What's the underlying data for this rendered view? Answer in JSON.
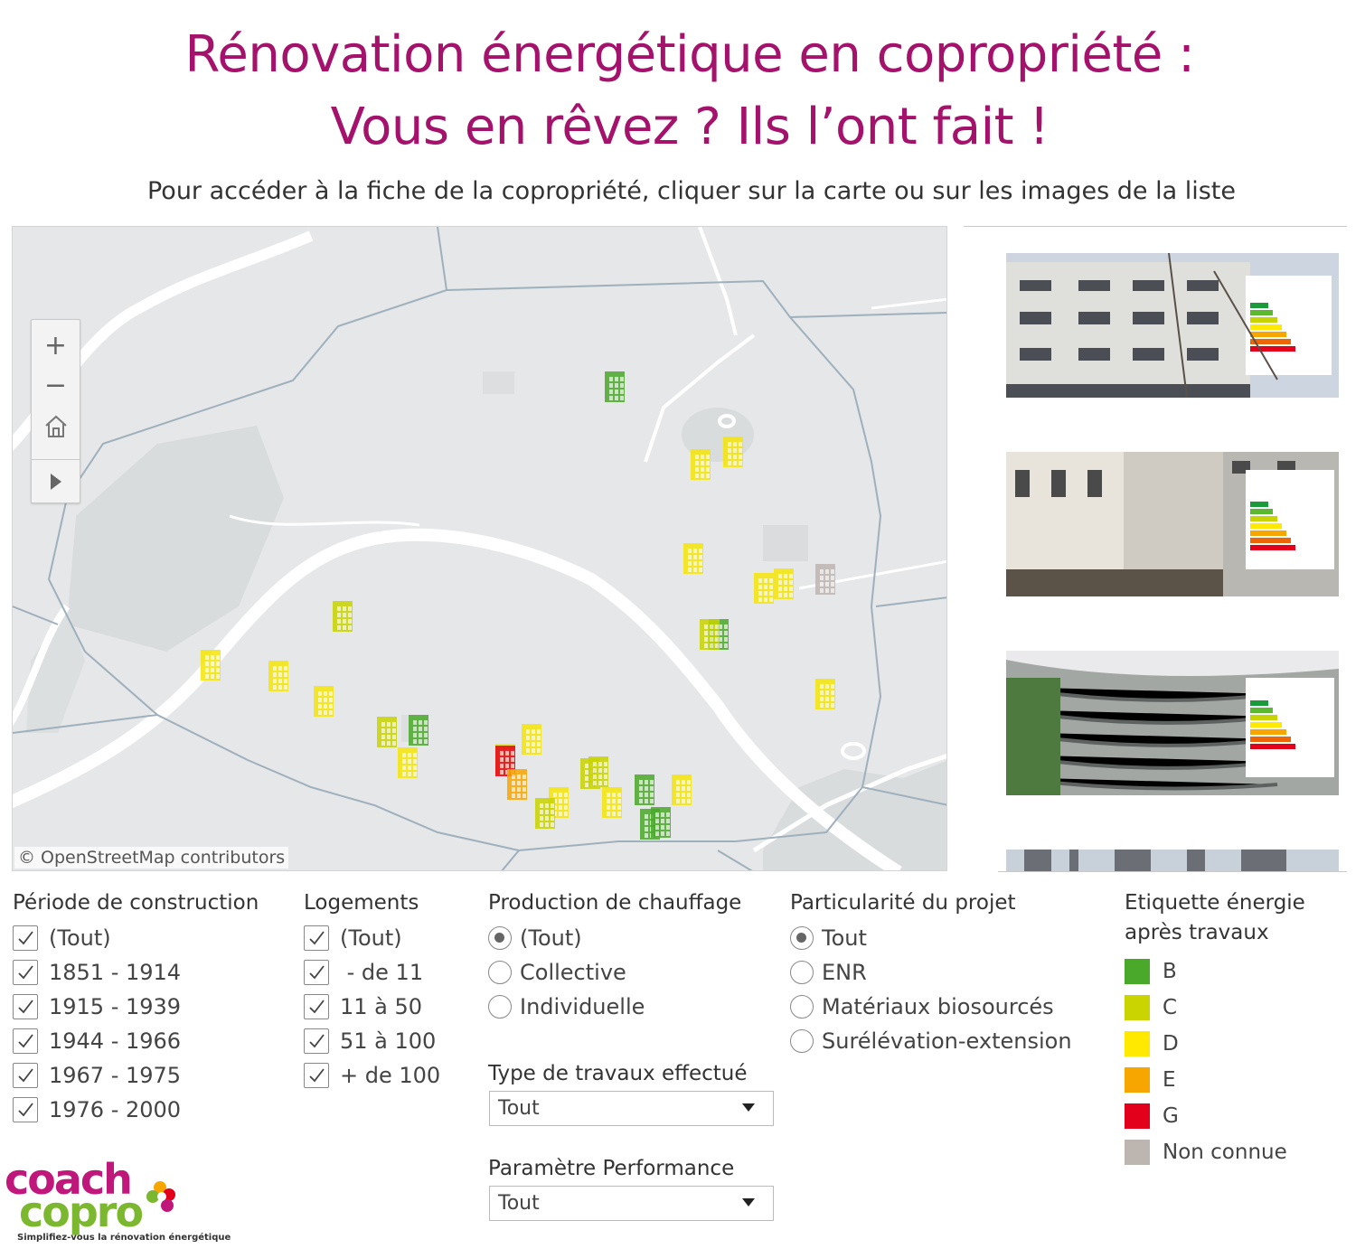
{
  "header": {
    "title_line1": "Rénovation énergétique en copropriété :",
    "title_line2": "Vous en rêvez ? Ils l’ont fait !",
    "subtitle": "Pour accéder à la fiche de la copropriété, cliquer sur la carte ou sur les images de la liste"
  },
  "map": {
    "attribution": "© OpenStreetMap contributors",
    "controls": {
      "zoom_in": "+",
      "zoom_out": "−",
      "home": "home-icon",
      "play": "play-icon"
    },
    "markers": [
      {
        "label": "B",
        "color": "#4aa82b"
      },
      {
        "label": "D",
        "color": "#f5e50a"
      },
      {
        "label": "D",
        "color": "#f5e50a"
      },
      {
        "label": "D",
        "color": "#f5e50a"
      },
      {
        "label": "D",
        "color": "#f5e50a"
      },
      {
        "label": "D",
        "color": "#f5e50a"
      },
      {
        "label": "Non connue",
        "color": "#bdb5b0"
      },
      {
        "label": "C",
        "color": "#c9d400"
      },
      {
        "label": "B",
        "color": "#4aa82b"
      },
      {
        "label": "C",
        "color": "#c9d400"
      },
      {
        "label": "D",
        "color": "#f5e50a"
      },
      {
        "label": "D",
        "color": "#f5e50a"
      },
      {
        "label": "D",
        "color": "#f5e50a"
      },
      {
        "label": "C",
        "color": "#c9d400"
      },
      {
        "label": "B",
        "color": "#4aa82b"
      },
      {
        "label": "D",
        "color": "#f5e50a"
      },
      {
        "label": "D",
        "color": "#f5e50a"
      },
      {
        "label": "D",
        "color": "#f5e50a"
      },
      {
        "label": "G",
        "color": "#e2001a"
      },
      {
        "label": "E",
        "color": "#f7a600"
      },
      {
        "label": "D",
        "color": "#f5e50a"
      },
      {
        "label": "C",
        "color": "#c9d400"
      },
      {
        "label": "D",
        "color": "#f5e50a"
      },
      {
        "label": "B",
        "color": "#4aa82b"
      },
      {
        "label": "C",
        "color": "#c9d400"
      },
      {
        "label": "D",
        "color": "#f5e50a"
      },
      {
        "label": "B",
        "color": "#4aa82b"
      },
      {
        "label": "B",
        "color": "#4aa82b"
      },
      {
        "label": "D",
        "color": "#f5e50a"
      },
      {
        "label": "C",
        "color": "#c9d400"
      }
    ]
  },
  "filters": {
    "periode": {
      "title": "Période de construction",
      "options": [
        "(Tout)",
        "1851 - 1914",
        "1915 - 1939",
        "1944 - 1966",
        "1967 - 1975",
        "1976 - 2000"
      ]
    },
    "logements": {
      "title": "Logements",
      "options": [
        "(Tout)",
        " - de 11",
        "11 à 50",
        "51 à 100",
        "+ de 100"
      ]
    },
    "chauffage": {
      "title": "Production de chauffage",
      "options": [
        "(Tout)",
        "Collective",
        "Individuelle"
      ],
      "selected": "(Tout)"
    },
    "particularite": {
      "title": "Particularité du projet",
      "options": [
        "Tout",
        "ENR",
        "Matériaux biosourcés",
        "Surélévation-extension"
      ],
      "selected": "Tout"
    },
    "type_travaux": {
      "title": "Type de travaux effectué",
      "value": "Tout"
    },
    "performance": {
      "title": "Paramètre Performance",
      "value": "Tout"
    }
  },
  "legend": {
    "title_line1": "Etiquette énergie",
    "title_line2": "après travaux",
    "items": [
      {
        "label": "B",
        "color": "#4aa82b"
      },
      {
        "label": "C",
        "color": "#c9d400"
      },
      {
        "label": "D",
        "color": "#ffe900"
      },
      {
        "label": "E",
        "color": "#f7a600"
      },
      {
        "label": "G",
        "color": "#e2001a"
      },
      {
        "label": "Non connue",
        "color": "#bdb5b0"
      }
    ]
  },
  "logo": {
    "part1": "coach",
    "part2": "copro",
    "tagline": "Simplifiez-vous la rénovation énergétique"
  }
}
